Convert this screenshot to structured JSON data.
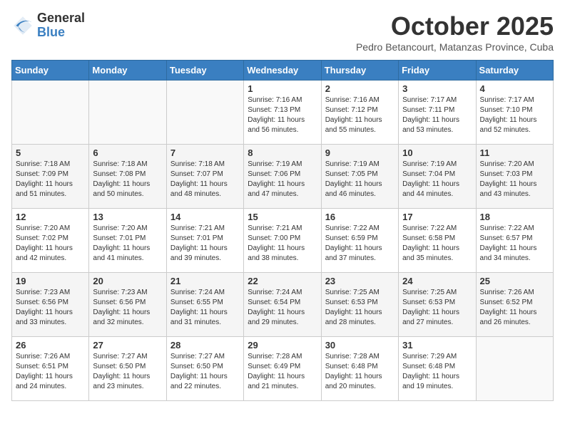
{
  "header": {
    "logo_general": "General",
    "logo_blue": "Blue",
    "month_title": "October 2025",
    "location": "Pedro Betancourt, Matanzas Province, Cuba"
  },
  "days_of_week": [
    "Sunday",
    "Monday",
    "Tuesday",
    "Wednesday",
    "Thursday",
    "Friday",
    "Saturday"
  ],
  "weeks": [
    [
      {
        "day": "",
        "info": ""
      },
      {
        "day": "",
        "info": ""
      },
      {
        "day": "",
        "info": ""
      },
      {
        "day": "1",
        "info": "Sunrise: 7:16 AM\nSunset: 7:13 PM\nDaylight: 11 hours\nand 56 minutes."
      },
      {
        "day": "2",
        "info": "Sunrise: 7:16 AM\nSunset: 7:12 PM\nDaylight: 11 hours\nand 55 minutes."
      },
      {
        "day": "3",
        "info": "Sunrise: 7:17 AM\nSunset: 7:11 PM\nDaylight: 11 hours\nand 53 minutes."
      },
      {
        "day": "4",
        "info": "Sunrise: 7:17 AM\nSunset: 7:10 PM\nDaylight: 11 hours\nand 52 minutes."
      }
    ],
    [
      {
        "day": "5",
        "info": "Sunrise: 7:18 AM\nSunset: 7:09 PM\nDaylight: 11 hours\nand 51 minutes."
      },
      {
        "day": "6",
        "info": "Sunrise: 7:18 AM\nSunset: 7:08 PM\nDaylight: 11 hours\nand 50 minutes."
      },
      {
        "day": "7",
        "info": "Sunrise: 7:18 AM\nSunset: 7:07 PM\nDaylight: 11 hours\nand 48 minutes."
      },
      {
        "day": "8",
        "info": "Sunrise: 7:19 AM\nSunset: 7:06 PM\nDaylight: 11 hours\nand 47 minutes."
      },
      {
        "day": "9",
        "info": "Sunrise: 7:19 AM\nSunset: 7:05 PM\nDaylight: 11 hours\nand 46 minutes."
      },
      {
        "day": "10",
        "info": "Sunrise: 7:19 AM\nSunset: 7:04 PM\nDaylight: 11 hours\nand 44 minutes."
      },
      {
        "day": "11",
        "info": "Sunrise: 7:20 AM\nSunset: 7:03 PM\nDaylight: 11 hours\nand 43 minutes."
      }
    ],
    [
      {
        "day": "12",
        "info": "Sunrise: 7:20 AM\nSunset: 7:02 PM\nDaylight: 11 hours\nand 42 minutes."
      },
      {
        "day": "13",
        "info": "Sunrise: 7:20 AM\nSunset: 7:01 PM\nDaylight: 11 hours\nand 41 minutes."
      },
      {
        "day": "14",
        "info": "Sunrise: 7:21 AM\nSunset: 7:01 PM\nDaylight: 11 hours\nand 39 minutes."
      },
      {
        "day": "15",
        "info": "Sunrise: 7:21 AM\nSunset: 7:00 PM\nDaylight: 11 hours\nand 38 minutes."
      },
      {
        "day": "16",
        "info": "Sunrise: 7:22 AM\nSunset: 6:59 PM\nDaylight: 11 hours\nand 37 minutes."
      },
      {
        "day": "17",
        "info": "Sunrise: 7:22 AM\nSunset: 6:58 PM\nDaylight: 11 hours\nand 35 minutes."
      },
      {
        "day": "18",
        "info": "Sunrise: 7:22 AM\nSunset: 6:57 PM\nDaylight: 11 hours\nand 34 minutes."
      }
    ],
    [
      {
        "day": "19",
        "info": "Sunrise: 7:23 AM\nSunset: 6:56 PM\nDaylight: 11 hours\nand 33 minutes."
      },
      {
        "day": "20",
        "info": "Sunrise: 7:23 AM\nSunset: 6:56 PM\nDaylight: 11 hours\nand 32 minutes."
      },
      {
        "day": "21",
        "info": "Sunrise: 7:24 AM\nSunset: 6:55 PM\nDaylight: 11 hours\nand 31 minutes."
      },
      {
        "day": "22",
        "info": "Sunrise: 7:24 AM\nSunset: 6:54 PM\nDaylight: 11 hours\nand 29 minutes."
      },
      {
        "day": "23",
        "info": "Sunrise: 7:25 AM\nSunset: 6:53 PM\nDaylight: 11 hours\nand 28 minutes."
      },
      {
        "day": "24",
        "info": "Sunrise: 7:25 AM\nSunset: 6:53 PM\nDaylight: 11 hours\nand 27 minutes."
      },
      {
        "day": "25",
        "info": "Sunrise: 7:26 AM\nSunset: 6:52 PM\nDaylight: 11 hours\nand 26 minutes."
      }
    ],
    [
      {
        "day": "26",
        "info": "Sunrise: 7:26 AM\nSunset: 6:51 PM\nDaylight: 11 hours\nand 24 minutes."
      },
      {
        "day": "27",
        "info": "Sunrise: 7:27 AM\nSunset: 6:50 PM\nDaylight: 11 hours\nand 23 minutes."
      },
      {
        "day": "28",
        "info": "Sunrise: 7:27 AM\nSunset: 6:50 PM\nDaylight: 11 hours\nand 22 minutes."
      },
      {
        "day": "29",
        "info": "Sunrise: 7:28 AM\nSunset: 6:49 PM\nDaylight: 11 hours\nand 21 minutes."
      },
      {
        "day": "30",
        "info": "Sunrise: 7:28 AM\nSunset: 6:48 PM\nDaylight: 11 hours\nand 20 minutes."
      },
      {
        "day": "31",
        "info": "Sunrise: 7:29 AM\nSunset: 6:48 PM\nDaylight: 11 hours\nand 19 minutes."
      },
      {
        "day": "",
        "info": ""
      }
    ]
  ]
}
